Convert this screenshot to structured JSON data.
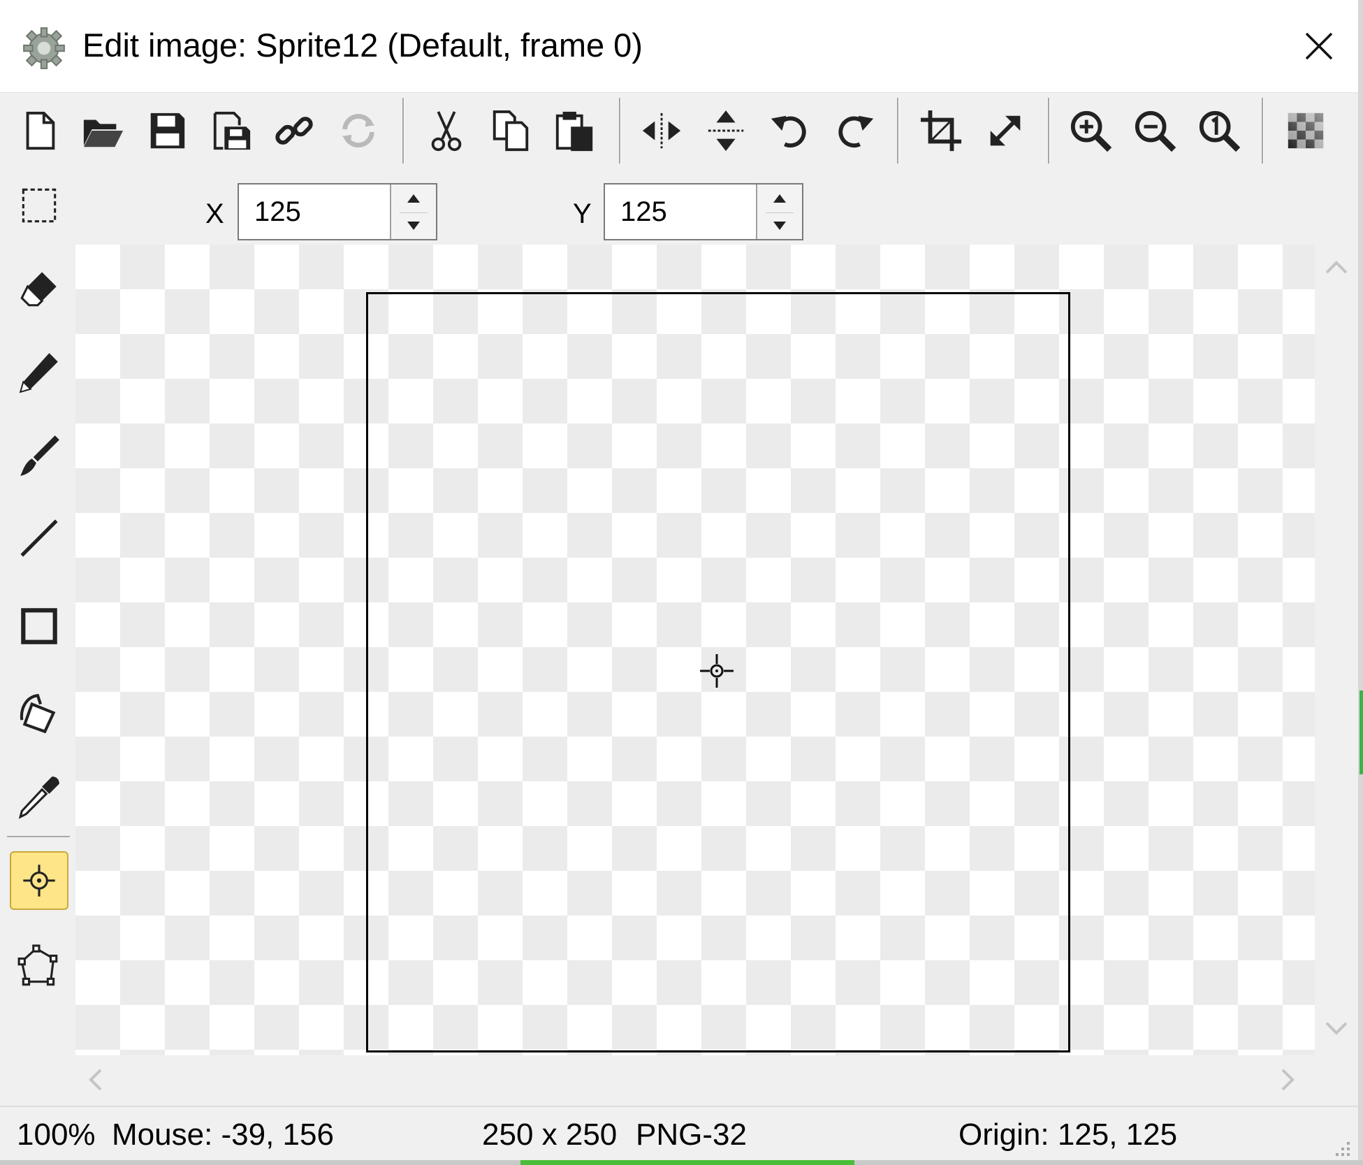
{
  "window": {
    "title": "Edit image: Sprite12 (Default, frame 0)"
  },
  "toolbar": {
    "groups": [
      [
        "new-icon",
        "open-icon",
        "save-icon",
        "save-as-icon",
        "link-icon",
        "reload-icon"
      ],
      [
        "cut-icon",
        "copy-icon",
        "paste-icon"
      ],
      [
        "flip-horizontal-icon",
        "flip-vertical-icon",
        "rotate-left-icon",
        "rotate-right-icon"
      ],
      [
        "crop-icon",
        "resize-icon"
      ],
      [
        "zoom-in-icon",
        "zoom-out-icon",
        "zoom-reset-icon"
      ],
      [
        "checkerboard-icon"
      ]
    ]
  },
  "tools": [
    "select",
    "eraser",
    "pencil",
    "brush",
    "line",
    "rectangle",
    "fill",
    "color-picker",
    "origin",
    "polygon"
  ],
  "active_tool": "origin",
  "origin_fields": {
    "x_label": "X",
    "x_value": "125",
    "y_label": "Y",
    "y_value": "125"
  },
  "status": {
    "zoom": "100%",
    "mouse": "Mouse: -39, 156",
    "size": "250 x 250",
    "format": "PNG-32",
    "origin": "Origin: 125, 125"
  },
  "colors": {
    "titlebar_bg": "#ffffff",
    "window_bg": "#f0f0f0",
    "active_tool_bg": "#fde588",
    "checker_dark": "#ebebeb",
    "checker_light": "#ffffff"
  }
}
